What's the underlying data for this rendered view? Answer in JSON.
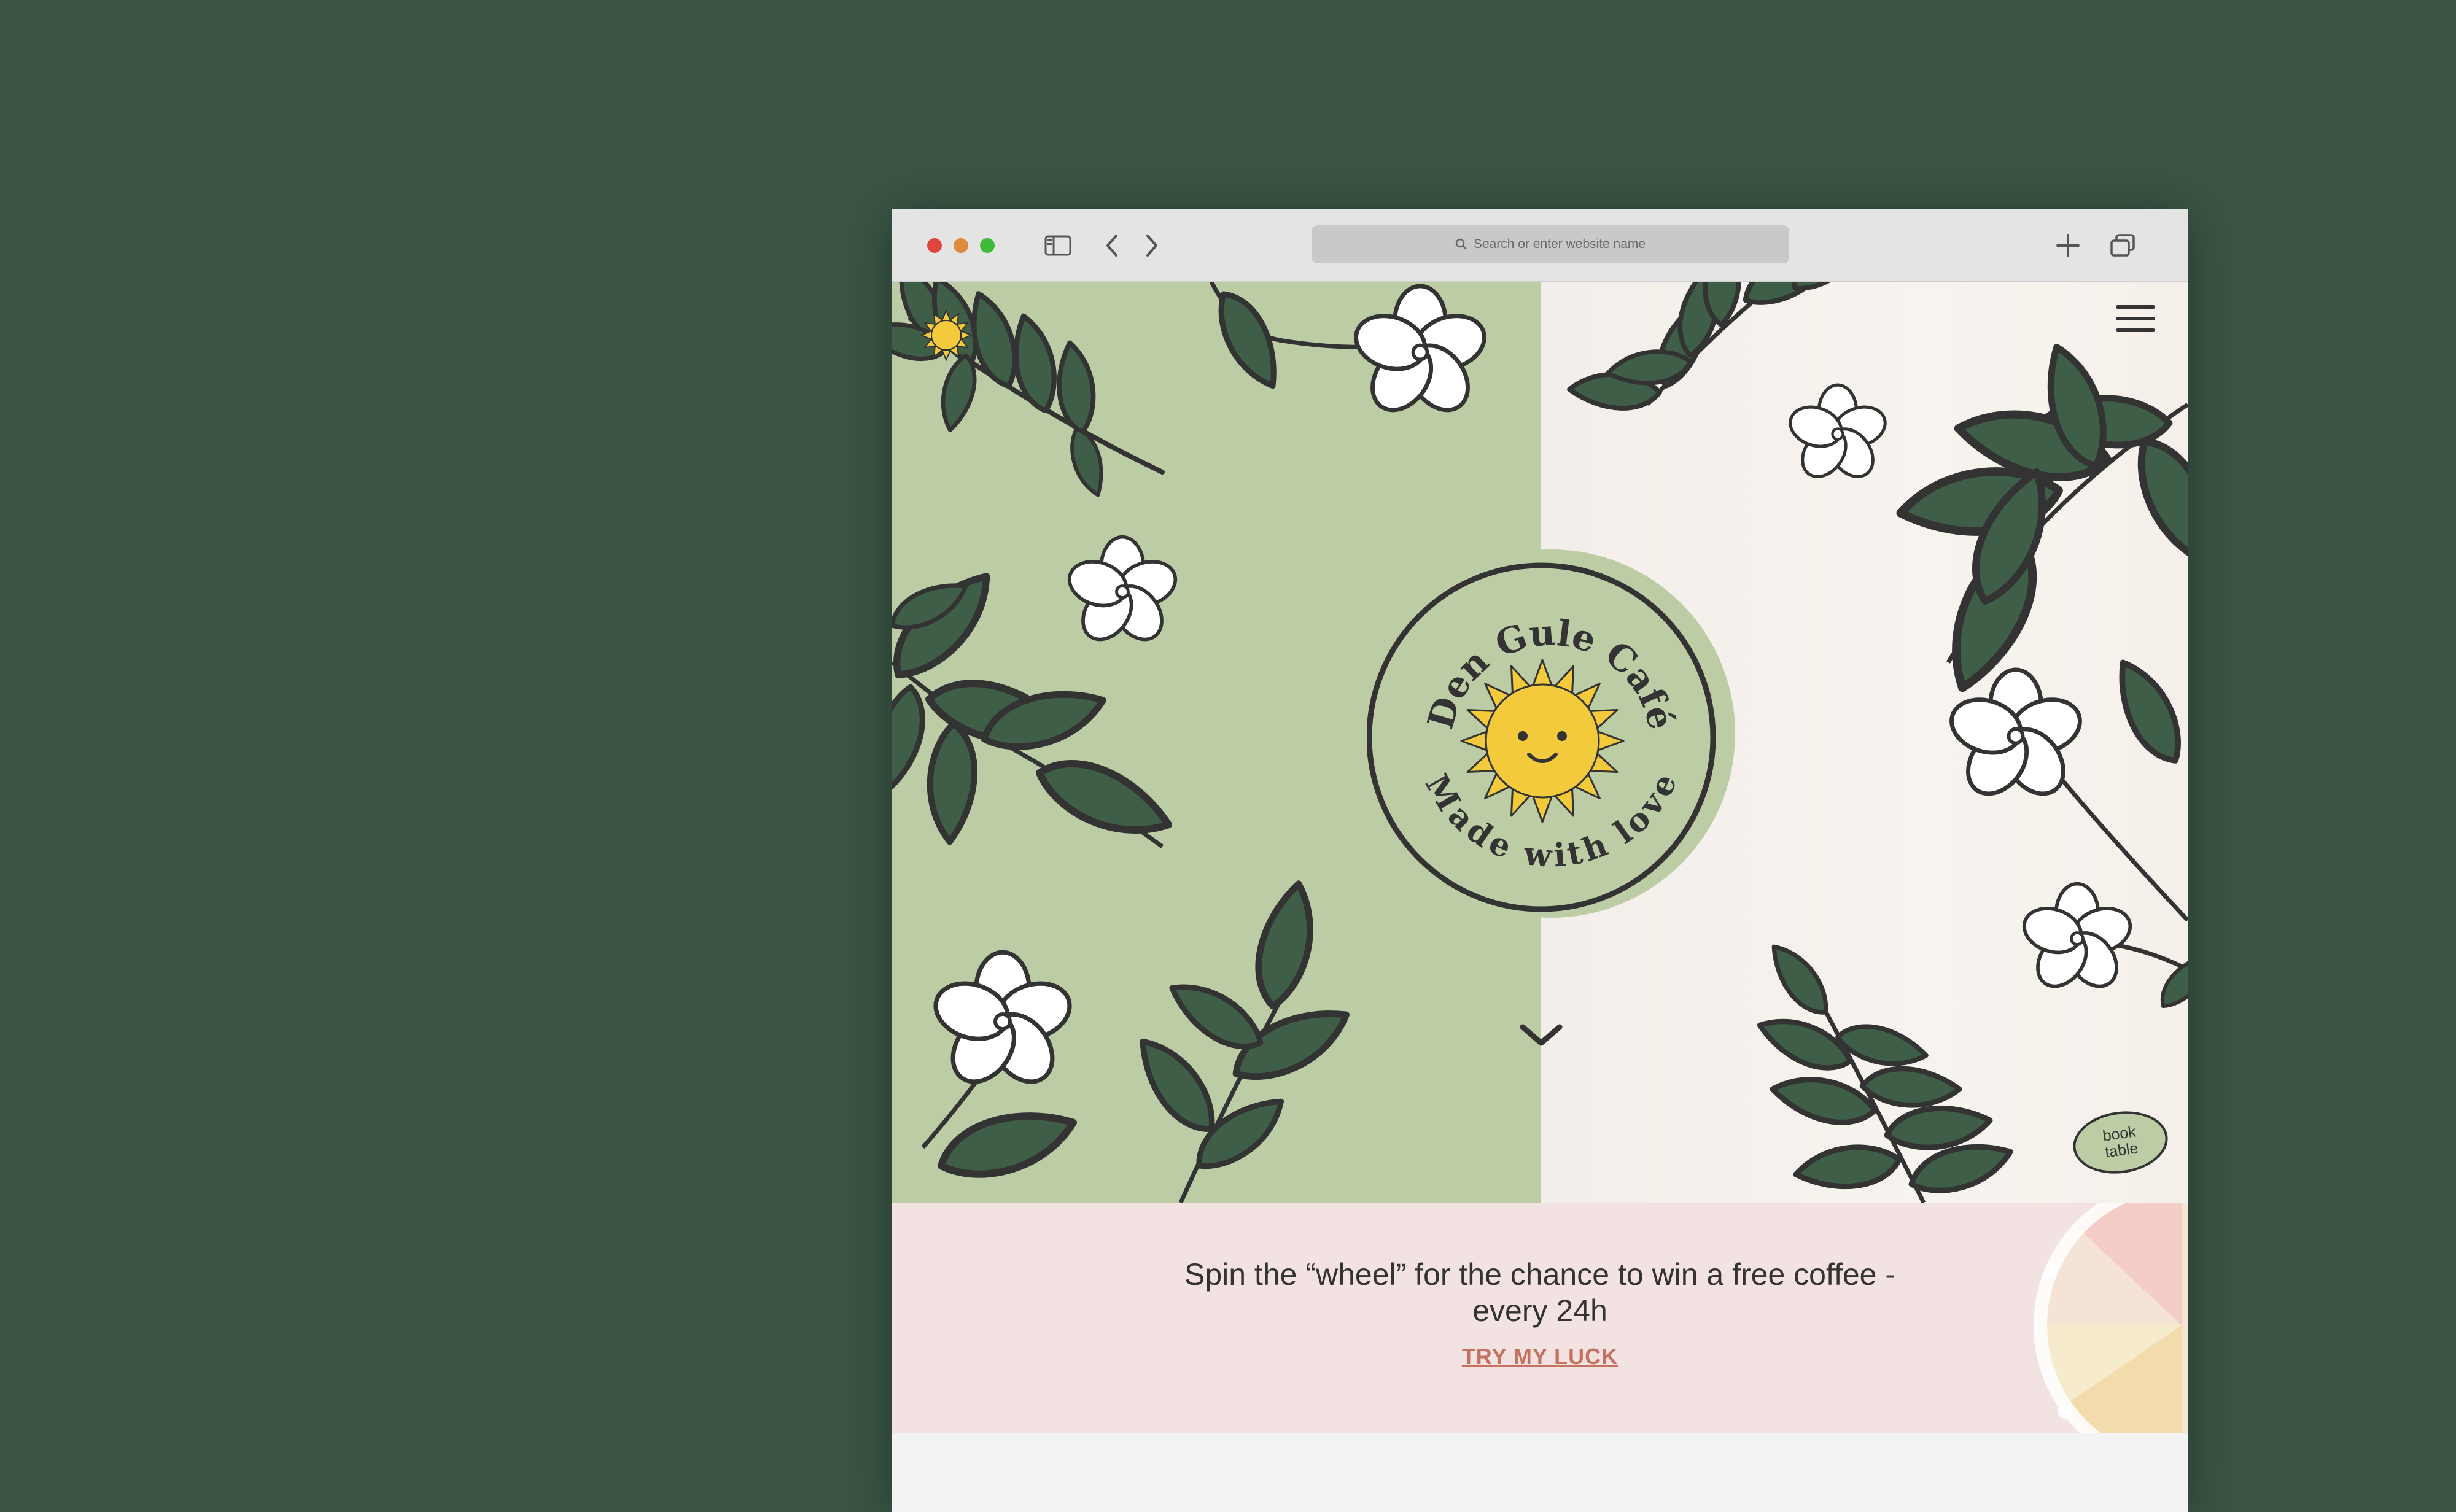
{
  "browser": {
    "url_placeholder": "Search or enter website name",
    "icons": [
      "sidebar-icon",
      "back-icon",
      "forward-icon",
      "new-tab-icon",
      "tabs-overview-icon",
      "search-icon"
    ]
  },
  "hero": {
    "logo_top_text": "Den Gule Café",
    "logo_bottom_text": "Made with love",
    "book_button": {
      "line1": "book",
      "line2": "table"
    }
  },
  "promo": {
    "text": "Spin the “wheel” for the chance to win a free coffee - every 24h",
    "link": "TRY MY LUCK"
  },
  "colors": {
    "background": "#3a5544",
    "sage": "#bccca4",
    "cream": "#f5f0ea",
    "leaf": "#3f5e48",
    "outline": "#333333",
    "sun": "#f2ca3c",
    "promo_bg": "#f2e2e1",
    "link": "#c4715f"
  }
}
